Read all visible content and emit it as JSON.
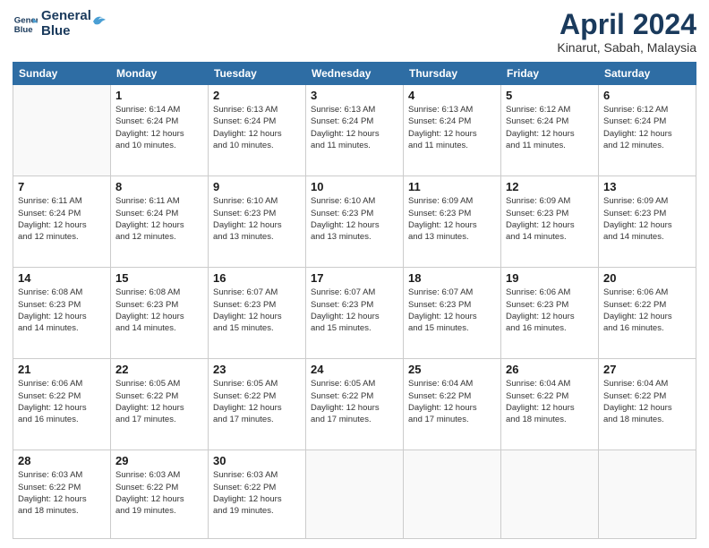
{
  "logo": {
    "line1": "General",
    "line2": "Blue"
  },
  "title": "April 2024",
  "subtitle": "Kinarut, Sabah, Malaysia",
  "days_of_week": [
    "Sunday",
    "Monday",
    "Tuesday",
    "Wednesday",
    "Thursday",
    "Friday",
    "Saturday"
  ],
  "weeks": [
    [
      {
        "day": "",
        "info": ""
      },
      {
        "day": "1",
        "info": "Sunrise: 6:14 AM\nSunset: 6:24 PM\nDaylight: 12 hours\nand 10 minutes."
      },
      {
        "day": "2",
        "info": "Sunrise: 6:13 AM\nSunset: 6:24 PM\nDaylight: 12 hours\nand 10 minutes."
      },
      {
        "day": "3",
        "info": "Sunrise: 6:13 AM\nSunset: 6:24 PM\nDaylight: 12 hours\nand 11 minutes."
      },
      {
        "day": "4",
        "info": "Sunrise: 6:13 AM\nSunset: 6:24 PM\nDaylight: 12 hours\nand 11 minutes."
      },
      {
        "day": "5",
        "info": "Sunrise: 6:12 AM\nSunset: 6:24 PM\nDaylight: 12 hours\nand 11 minutes."
      },
      {
        "day": "6",
        "info": "Sunrise: 6:12 AM\nSunset: 6:24 PM\nDaylight: 12 hours\nand 12 minutes."
      }
    ],
    [
      {
        "day": "7",
        "info": "Sunrise: 6:11 AM\nSunset: 6:24 PM\nDaylight: 12 hours\nand 12 minutes."
      },
      {
        "day": "8",
        "info": "Sunrise: 6:11 AM\nSunset: 6:24 PM\nDaylight: 12 hours\nand 12 minutes."
      },
      {
        "day": "9",
        "info": "Sunrise: 6:10 AM\nSunset: 6:23 PM\nDaylight: 12 hours\nand 13 minutes."
      },
      {
        "day": "10",
        "info": "Sunrise: 6:10 AM\nSunset: 6:23 PM\nDaylight: 12 hours\nand 13 minutes."
      },
      {
        "day": "11",
        "info": "Sunrise: 6:09 AM\nSunset: 6:23 PM\nDaylight: 12 hours\nand 13 minutes."
      },
      {
        "day": "12",
        "info": "Sunrise: 6:09 AM\nSunset: 6:23 PM\nDaylight: 12 hours\nand 14 minutes."
      },
      {
        "day": "13",
        "info": "Sunrise: 6:09 AM\nSunset: 6:23 PM\nDaylight: 12 hours\nand 14 minutes."
      }
    ],
    [
      {
        "day": "14",
        "info": "Sunrise: 6:08 AM\nSunset: 6:23 PM\nDaylight: 12 hours\nand 14 minutes."
      },
      {
        "day": "15",
        "info": "Sunrise: 6:08 AM\nSunset: 6:23 PM\nDaylight: 12 hours\nand 14 minutes."
      },
      {
        "day": "16",
        "info": "Sunrise: 6:07 AM\nSunset: 6:23 PM\nDaylight: 12 hours\nand 15 minutes."
      },
      {
        "day": "17",
        "info": "Sunrise: 6:07 AM\nSunset: 6:23 PM\nDaylight: 12 hours\nand 15 minutes."
      },
      {
        "day": "18",
        "info": "Sunrise: 6:07 AM\nSunset: 6:23 PM\nDaylight: 12 hours\nand 15 minutes."
      },
      {
        "day": "19",
        "info": "Sunrise: 6:06 AM\nSunset: 6:23 PM\nDaylight: 12 hours\nand 16 minutes."
      },
      {
        "day": "20",
        "info": "Sunrise: 6:06 AM\nSunset: 6:22 PM\nDaylight: 12 hours\nand 16 minutes."
      }
    ],
    [
      {
        "day": "21",
        "info": "Sunrise: 6:06 AM\nSunset: 6:22 PM\nDaylight: 12 hours\nand 16 minutes."
      },
      {
        "day": "22",
        "info": "Sunrise: 6:05 AM\nSunset: 6:22 PM\nDaylight: 12 hours\nand 17 minutes."
      },
      {
        "day": "23",
        "info": "Sunrise: 6:05 AM\nSunset: 6:22 PM\nDaylight: 12 hours\nand 17 minutes."
      },
      {
        "day": "24",
        "info": "Sunrise: 6:05 AM\nSunset: 6:22 PM\nDaylight: 12 hours\nand 17 minutes."
      },
      {
        "day": "25",
        "info": "Sunrise: 6:04 AM\nSunset: 6:22 PM\nDaylight: 12 hours\nand 17 minutes."
      },
      {
        "day": "26",
        "info": "Sunrise: 6:04 AM\nSunset: 6:22 PM\nDaylight: 12 hours\nand 18 minutes."
      },
      {
        "day": "27",
        "info": "Sunrise: 6:04 AM\nSunset: 6:22 PM\nDaylight: 12 hours\nand 18 minutes."
      }
    ],
    [
      {
        "day": "28",
        "info": "Sunrise: 6:03 AM\nSunset: 6:22 PM\nDaylight: 12 hours\nand 18 minutes."
      },
      {
        "day": "29",
        "info": "Sunrise: 6:03 AM\nSunset: 6:22 PM\nDaylight: 12 hours\nand 19 minutes."
      },
      {
        "day": "30",
        "info": "Sunrise: 6:03 AM\nSunset: 6:22 PM\nDaylight: 12 hours\nand 19 minutes."
      },
      {
        "day": "",
        "info": ""
      },
      {
        "day": "",
        "info": ""
      },
      {
        "day": "",
        "info": ""
      },
      {
        "day": "",
        "info": ""
      }
    ]
  ]
}
